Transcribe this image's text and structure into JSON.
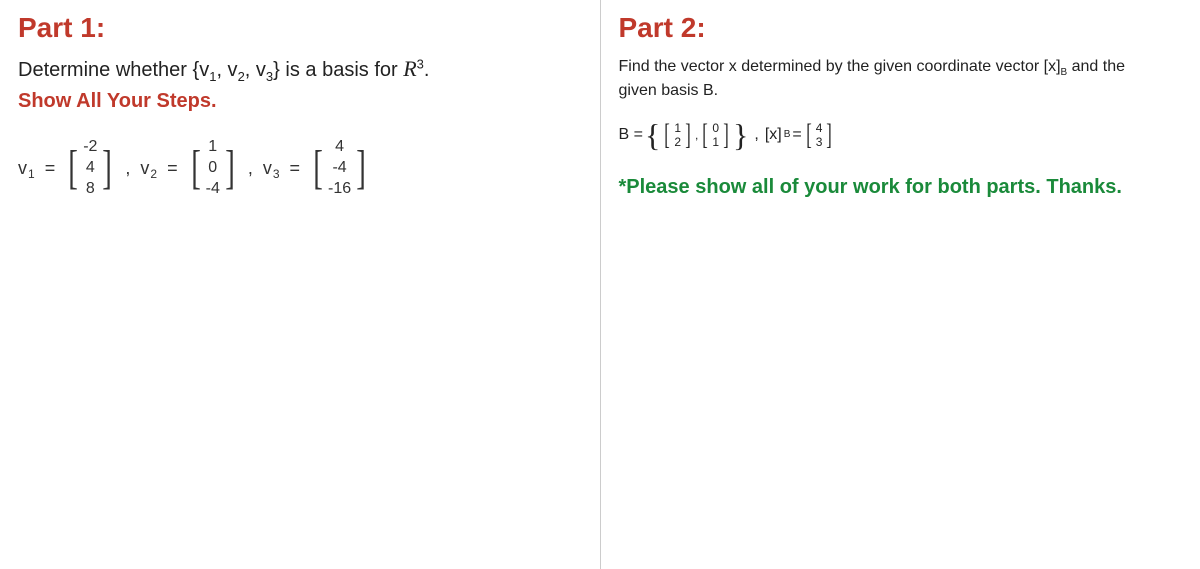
{
  "part1": {
    "title": "Part 1:",
    "prompt_pre": "Determine whether {v",
    "prompt_v1sub": "1",
    "prompt_mid1": ", v",
    "prompt_v2sub": "2",
    "prompt_mid2": ", v",
    "prompt_v3sub": "3",
    "prompt_post": "} is a basis for ",
    "R_symbol": "R",
    "R_sup": "3",
    "period": ".",
    "show_steps": "Show All Your Steps.",
    "v1_label": "v",
    "v1_sub": "1",
    "v2_label": "v",
    "v2_sub": "2",
    "v3_label": "v",
    "v3_sub": "3",
    "eq": "=",
    "comma": ",",
    "v1_vals": [
      "-2",
      "4",
      "8"
    ],
    "v2_vals": [
      "1",
      "0",
      "-4"
    ],
    "v3_vals": [
      "4",
      "-4",
      "-16"
    ]
  },
  "part2": {
    "title": "Part 2:",
    "prompt_line1": "Find the vector x determined by the given coordinate vector [x]",
    "prompt_B": "B",
    "prompt_line1_end": " and the",
    "prompt_line2": "given basis B.",
    "B_label": "B =",
    "b1_vals": [
      "1",
      "2"
    ],
    "b2_vals": [
      "0",
      "1"
    ],
    "xb_label": "[x]",
    "xb_sub": "B",
    "xb_eq": " =",
    "xb_vals": [
      "4",
      "3"
    ],
    "comma": ",",
    "please": "*Please show all of your work for both parts. Thanks."
  }
}
